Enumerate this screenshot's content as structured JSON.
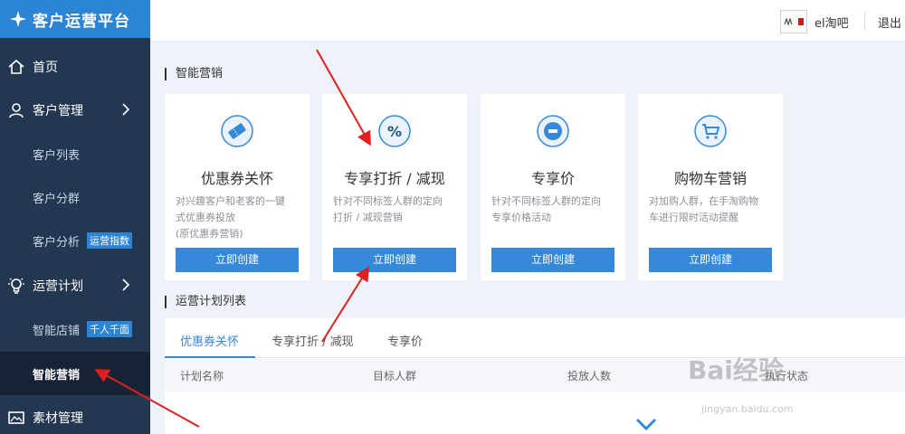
{
  "app": {
    "title": "客户运营平台"
  },
  "header": {
    "username": "el淘吧",
    "logout": "退出"
  },
  "sidebar": {
    "items": [
      {
        "label": "首页",
        "type": "top",
        "icon": "home-icon"
      },
      {
        "label": "客户管理",
        "type": "top",
        "icon": "user-icon",
        "expandable": true
      },
      {
        "label": "客户列表",
        "type": "sub"
      },
      {
        "label": "客户分群",
        "type": "sub"
      },
      {
        "label": "客户分析",
        "type": "sub",
        "badge": "运营指数"
      },
      {
        "label": "运营计划",
        "type": "top",
        "icon": "bulb-icon",
        "expandable": true
      },
      {
        "label": "智能店铺",
        "type": "sub",
        "badge": "千人千面"
      },
      {
        "label": "智能营销",
        "type": "sub",
        "active": true
      },
      {
        "label": "素材管理",
        "type": "top",
        "icon": "image-icon"
      }
    ]
  },
  "main": {
    "section_marketing": "智能营销",
    "cards": [
      {
        "title": "优惠券关怀",
        "desc": [
          "对兴趣客户和老客的一键",
          "式优惠券投放",
          "(原优惠券营销)"
        ],
        "button": "立即创建",
        "icon": "ticket-icon"
      },
      {
        "title": "专享打折 / 减现",
        "desc": [
          "针对不同标签人群的定向",
          "打折 / 减现营销"
        ],
        "button": "立即创建",
        "icon": "percent-icon"
      },
      {
        "title": "专享价",
        "desc": [
          "针对不同标签人群的定向",
          "专享价格活动"
        ],
        "button": "立即创建",
        "icon": "zhuan-icon"
      },
      {
        "title": "购物车营销",
        "desc": [
          "对加购人群，在手淘购物",
          "车进行限时活动提醒"
        ],
        "button": "立即创建",
        "icon": "cart-icon"
      }
    ],
    "section_plans": "运营计划列表",
    "tabs": [
      {
        "label": "优惠券关怀",
        "active": true
      },
      {
        "label": "专享打折 / 减现",
        "active": false
      },
      {
        "label": "专享价",
        "active": false
      }
    ],
    "table_headers": [
      "计划名称",
      "目标人群",
      "投放人数",
      "执行状态"
    ]
  },
  "watermark": {
    "brand": "Bai经验",
    "sub": "jingyan.baidu.com"
  },
  "colors": {
    "accent": "#3688d8",
    "sidebar": "#243750",
    "logo_bar": "#2c84d4",
    "arrow": "#e01f1f"
  }
}
